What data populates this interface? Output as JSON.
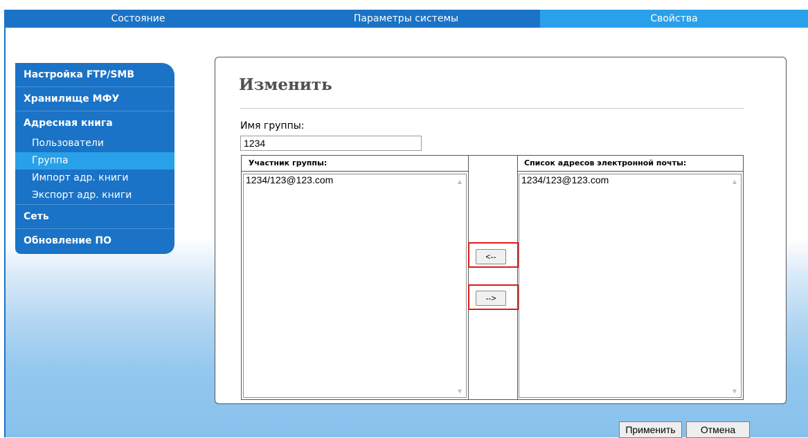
{
  "nav": {
    "tabs": [
      {
        "label": "Состояние"
      },
      {
        "label": "Параметры системы"
      },
      {
        "label": "Свойства"
      }
    ]
  },
  "sidebar": {
    "ftp_smb": "Настройка FTP/SMB",
    "storage": "Хранилище МФУ",
    "address_book": "Адресная книга",
    "sub_items": [
      {
        "label": "Пользователи"
      },
      {
        "label": "Группа"
      },
      {
        "label": "Импорт адр. книги"
      },
      {
        "label": "Экспорт адр. книги"
      }
    ],
    "network": "Сеть",
    "firmware": "Обновление ПО"
  },
  "panel": {
    "title": "Изменить",
    "group_name_label": "Имя группы:",
    "group_name_value": "1234",
    "members_header": "Участник группы:",
    "members": [
      "1234/123@123.com"
    ],
    "emails_header": "Список адресов электронной почты:",
    "emails": [
      "1234/123@123.com"
    ],
    "move_left_label": "<--",
    "move_right_label": "-->"
  },
  "actions": {
    "apply_label": "Применить",
    "cancel_label": "Отмена"
  },
  "colors": {
    "nav_bg": "#1a73c6",
    "nav_active": "#29a0ea",
    "highlight": "#e01a1a"
  }
}
